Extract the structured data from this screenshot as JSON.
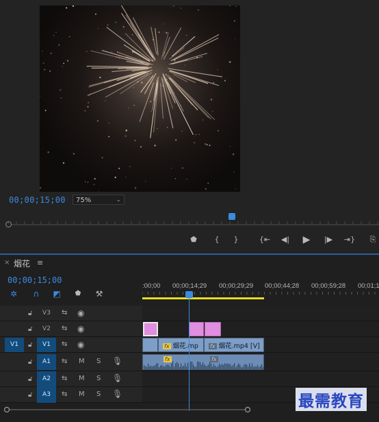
{
  "monitor": {
    "timecode": "00;00;15;00",
    "zoom": "75%",
    "transport": [
      {
        "icon": "marker-icon",
        "glyph": "⬟"
      },
      {
        "icon": "mark-in-icon",
        "glyph": "{"
      },
      {
        "icon": "mark-out-icon",
        "glyph": "}"
      },
      {
        "icon": "go-to-in-icon",
        "glyph": "{⇤"
      },
      {
        "icon": "step-back-icon",
        "glyph": "◀|"
      },
      {
        "icon": "play-icon",
        "glyph": "▶"
      },
      {
        "icon": "step-forward-icon",
        "glyph": "|▶"
      },
      {
        "icon": "go-to-out-icon",
        "glyph": "⇥}"
      },
      {
        "icon": "lift-icon",
        "glyph": "⎘"
      }
    ]
  },
  "timeline": {
    "close": "×",
    "title": "烟花",
    "menu": "≡",
    "timecode": "00;00;15;00",
    "ruler_labels": [
      ":00;00",
      "00;00;14;29",
      "00;00;29;29",
      "00;00;44;28",
      "00;00;59;28",
      "00;01;1"
    ],
    "tools": [
      {
        "icon": "nest-sequence-icon",
        "glyph": "✲",
        "color": "#3b8be0"
      },
      {
        "icon": "snap-magnet-icon",
        "glyph": "∩",
        "color": "#3b8be0"
      },
      {
        "icon": "linked-selection-icon",
        "glyph": "◩",
        "color": "#3b8be0"
      },
      {
        "icon": "add-marker-icon",
        "glyph": "⬟",
        "color": "#b8b8b8"
      },
      {
        "icon": "settings-wrench-icon",
        "glyph": "⚒",
        "color": "#b8b8b8"
      }
    ],
    "video_tracks": [
      {
        "name": "V3",
        "source": ""
      },
      {
        "name": "V2",
        "source": ""
      },
      {
        "name": "V1",
        "source": "V1"
      }
    ],
    "audio_tracks": [
      {
        "name": "A1",
        "m": "M",
        "s": "S"
      },
      {
        "name": "A2",
        "m": "M",
        "s": "S"
      },
      {
        "name": "A3",
        "m": "M",
        "s": "S"
      }
    ],
    "clips": {
      "v1_clip1_label": "烟花.mp",
      "v1_clip2_label": "烟花.mp4 [V]",
      "fx": "fx"
    }
  },
  "watermark": "最需教育",
  "colors": {
    "accent": "#3b8be0",
    "work_area": "#e8dc1e",
    "video_clip": "#7d9ec6",
    "graphic_clip": "#e08ee0",
    "track_selected": "#124c7d"
  }
}
